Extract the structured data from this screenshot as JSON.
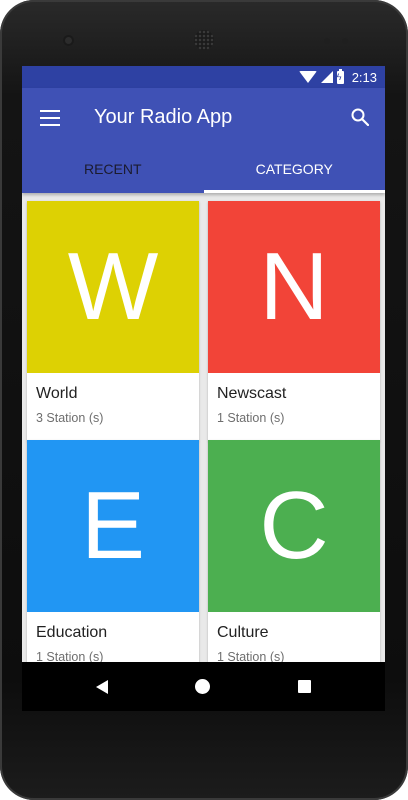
{
  "status_bar": {
    "time": "2:13"
  },
  "app_bar": {
    "title": "Your Radio App",
    "menu_icon": "hamburger-menu-icon",
    "search_icon": "search-icon"
  },
  "tabs": [
    {
      "label": "RECENT",
      "selected": false
    },
    {
      "label": "CATEGORY",
      "selected": true
    }
  ],
  "categories": [
    {
      "letter": "W",
      "name": "World",
      "count": "3 Station (s)",
      "color": "#ddd103"
    },
    {
      "letter": "N",
      "name": "Newscast",
      "count": "1 Station (s)",
      "color": "#f24438"
    },
    {
      "letter": "E",
      "name": "Education",
      "count": "1 Station (s)",
      "color": "#2196f3"
    },
    {
      "letter": "C",
      "name": "Culture",
      "count": "1 Station (s)",
      "color": "#4caf50"
    }
  ],
  "nav_bar": {
    "back_icon": "back-icon",
    "home_icon": "home-icon",
    "recents_icon": "recents-icon"
  },
  "colors": {
    "primary": "#3f51b5",
    "primary_dark": "#2e41a3",
    "background": "#e9e9e9"
  }
}
